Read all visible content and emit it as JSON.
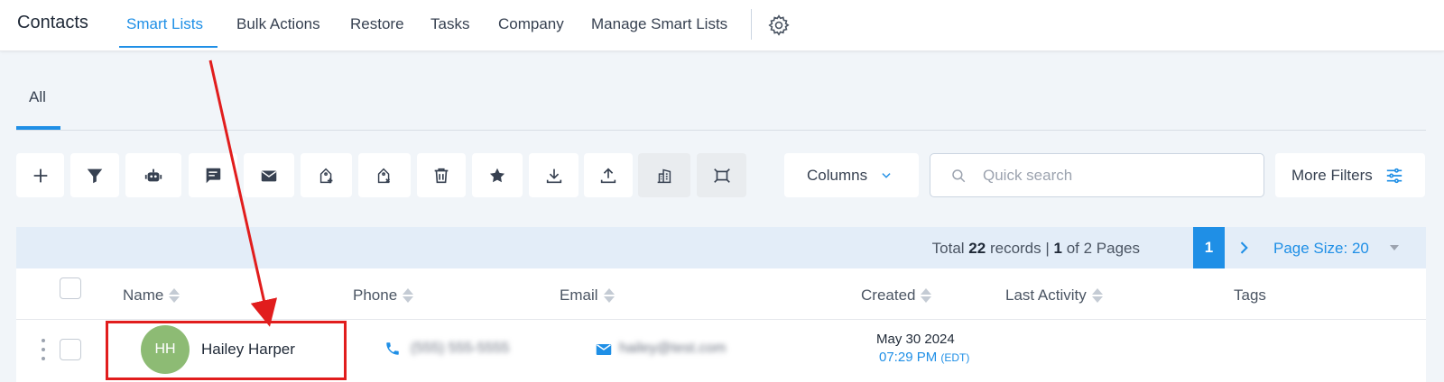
{
  "app": {
    "title": "Contacts"
  },
  "nav": {
    "tabs": [
      {
        "label": "Smart Lists",
        "active": true
      },
      {
        "label": "Bulk Actions"
      },
      {
        "label": "Restore"
      },
      {
        "label": "Tasks"
      },
      {
        "label": "Company"
      },
      {
        "label": "Manage Smart Lists"
      }
    ]
  },
  "subtabs": [
    {
      "label": "All",
      "active": true
    }
  ],
  "toolbar": {
    "icons": [
      "plus-icon",
      "filter-icon",
      "robot-icon",
      "message-icon",
      "email-icon",
      "tag-add-icon",
      "tag-remove-icon",
      "trash-icon",
      "star-icon",
      "download-icon",
      "upload-icon",
      "building-icon",
      "merge-icon"
    ],
    "columns_label": "Columns",
    "search_placeholder": "Quick search",
    "more_filters_label": "More Filters"
  },
  "pagination": {
    "records_prefix": "Total",
    "total_records": "22",
    "records_mid": "records |",
    "current_page": "1",
    "pages_suffix": "of 2 Pages",
    "page_size_label": "Page Size: 20"
  },
  "table": {
    "columns": [
      "Name",
      "Phone",
      "Email",
      "Created",
      "Last Activity",
      "Tags"
    ],
    "rows": [
      {
        "initials": "HH",
        "name": "Hailey Harper",
        "phone": "(555) 555-5555",
        "email": "hailey@test.com",
        "created_date": "May 30 2024",
        "created_time": "07:29 PM",
        "created_tz": "(EDT)"
      }
    ]
  },
  "colors": {
    "accent": "#1f8fe6",
    "avatar": "#8dbb74",
    "annotation": "#e11d1d"
  }
}
